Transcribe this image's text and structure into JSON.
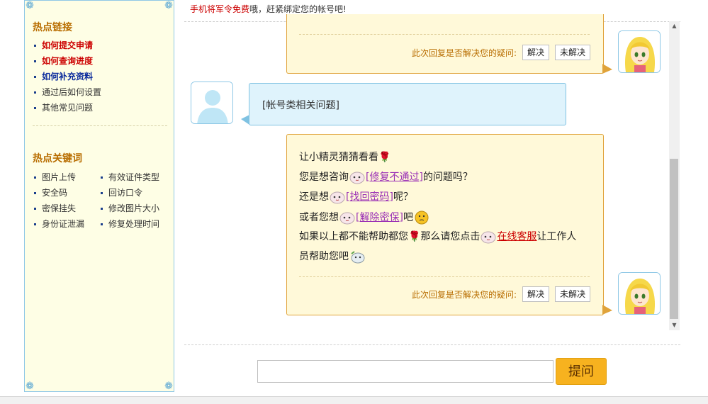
{
  "top_note": {
    "prefix": "手机将军令免费",
    "suffix": "哦，赶紧绑定您的帐号吧!"
  },
  "sidebar": {
    "hot_links_title": "热点链接",
    "hot_links": [
      {
        "label": "如何提交申请",
        "style": "red"
      },
      {
        "label": "如何查询进度",
        "style": "red"
      },
      {
        "label": "如何补充资料",
        "style": "blue"
      },
      {
        "label": "通过后如何设置",
        "style": "plain"
      },
      {
        "label": "其他常见问题",
        "style": "plain"
      }
    ],
    "keywords_title": "热点关键词",
    "keywords": [
      "图片上传",
      "有效证件类型",
      "安全码",
      "回访口令",
      "密保挂失",
      "修改图片大小",
      "身份证泄漏",
      "修复处理时间"
    ]
  },
  "chat": {
    "feedback_label": "此次回复是否解决您的疑问:",
    "resolved_label": "解决",
    "unresolved_label": "未解决",
    "user_message": "[帐号类相关问题]",
    "bot_reply": {
      "line1": "让小精灵猜猜看看",
      "line2_pre": "您是想咨询",
      "line2_link": "[修复不通过]",
      "line2_post": "的问题吗？",
      "line3_pre": "还是想",
      "line3_link": "[找回密码]",
      "line3_post": "呢？",
      "line4_pre": "或者您想",
      "line4_link": "[解除密保]",
      "line4_post": "吧",
      "line5_pre": "如果以上都不能帮助都您",
      "line5_mid": "那么请您点击",
      "line5_link": "在线客服",
      "line5_post": "让工作人",
      "line6": "员帮助您吧"
    }
  },
  "input": {
    "value": "",
    "submit_label": "提问"
  },
  "colors": {
    "accent": "#f7b21f",
    "link_red": "#cc0000",
    "link_purple": "#9a2fb5",
    "title_orange": "#b86d00",
    "sidebar_border": "#8fc8e6"
  }
}
